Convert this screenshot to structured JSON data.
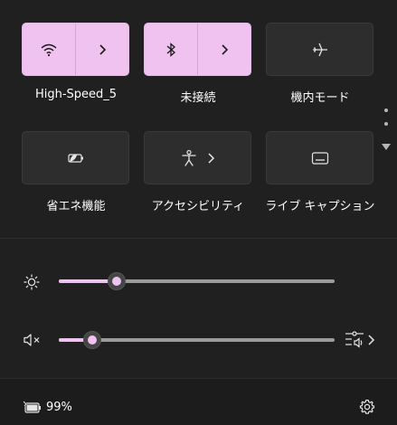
{
  "tiles": [
    {
      "id": "wifi",
      "label": "High-Speed_5",
      "state": "on",
      "icon": "wifi-icon",
      "has_chevron": true
    },
    {
      "id": "bluetooth",
      "label": "未接続",
      "state": "on",
      "icon": "bluetooth-icon",
      "has_chevron": true
    },
    {
      "id": "airplane",
      "label": "機内モード",
      "state": "off",
      "icon": "airplane-icon",
      "has_chevron": false
    },
    {
      "id": "battery_saver",
      "label": "省エネ機能",
      "state": "off",
      "icon": "battery-saver-icon",
      "has_chevron": false
    },
    {
      "id": "accessibility",
      "label": "アクセシビリティ",
      "state": "off",
      "icon": "accessibility-icon",
      "has_chevron": true
    },
    {
      "id": "live_captions",
      "label": "ライブ キャプション",
      "state": "off",
      "icon": "live-captions-icon",
      "has_chevron": false
    }
  ],
  "pager": {
    "pages": 2,
    "current": 1,
    "icon": "pager-down-icon"
  },
  "sliders": {
    "brightness": {
      "icon": "sun-icon",
      "level": 0.21
    },
    "volume": {
      "icon": "volume-muted-icon",
      "level": 0.12,
      "output_icon": "sound-output-icon"
    }
  },
  "footer": {
    "battery_percent": "99%",
    "battery_icon": "battery-charging-icon",
    "settings_icon": "gear-icon"
  },
  "colors": {
    "accent": "#f0c2f0",
    "background": "#202020",
    "tile_off": "#2d2d2d"
  }
}
